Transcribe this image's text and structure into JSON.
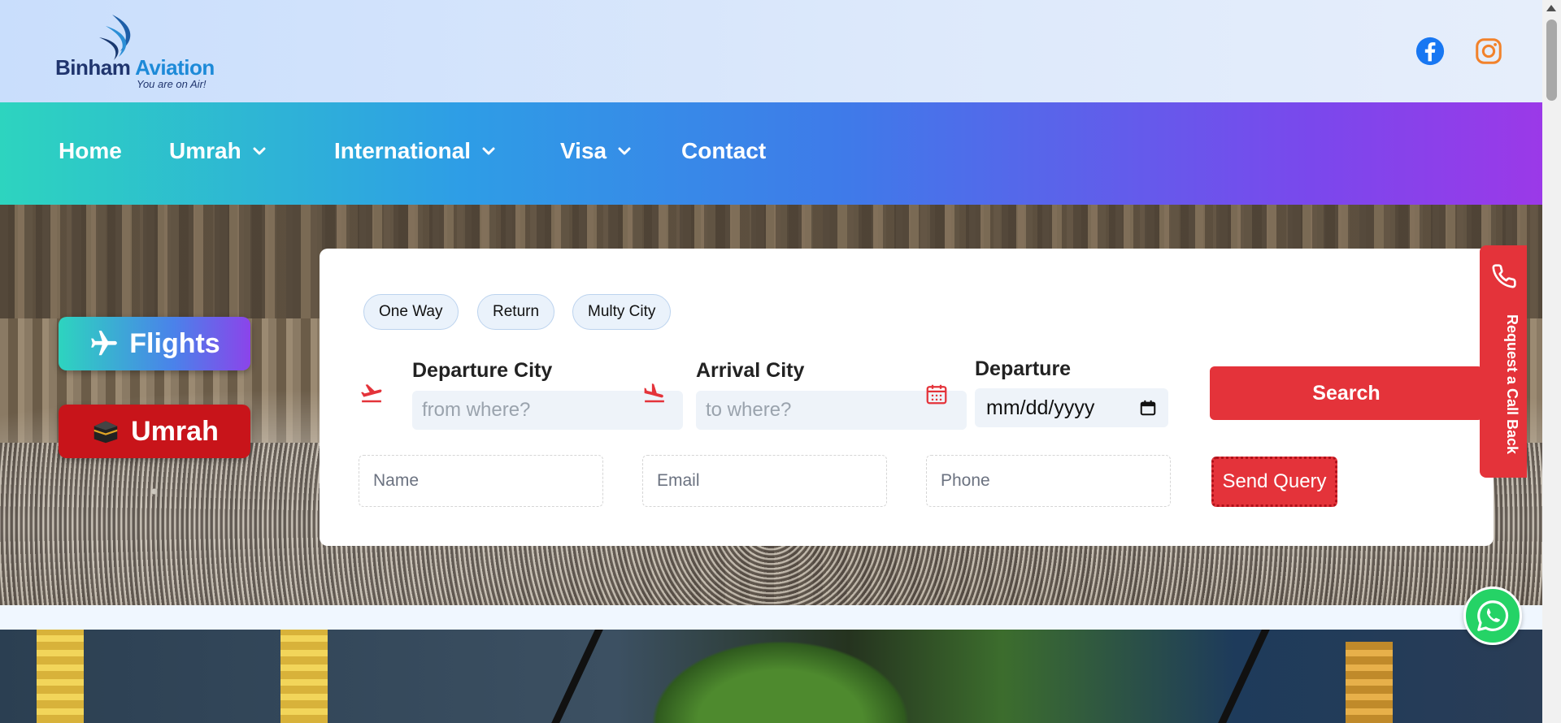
{
  "header": {
    "logo_brand_1": "Binham",
    "logo_brand_2": "Aviation",
    "logo_tagline": "You are on Air!",
    "social": [
      {
        "icon": "facebook-icon",
        "color": "#1877f2"
      },
      {
        "icon": "instagram-icon",
        "color": "#f2822b"
      }
    ]
  },
  "nav": {
    "items": [
      {
        "label": "Home",
        "has_dropdown": false
      },
      {
        "label": "Umrah",
        "has_dropdown": true
      },
      {
        "label": "International",
        "has_dropdown": true
      },
      {
        "label": "Visa",
        "has_dropdown": true
      },
      {
        "label": "Contact",
        "has_dropdown": false
      }
    ]
  },
  "side_tabs": {
    "flights": "Flights",
    "umrah": "Umrah"
  },
  "search": {
    "trip_types": [
      "One Way",
      "Return",
      "Multy City"
    ],
    "departure_label": "Departure City",
    "departure_placeholder": "from where?",
    "arrival_label": "Arrival City",
    "arrival_placeholder": "to where?",
    "date_label": "Departure",
    "date_placeholder": "mm/dd/yyyy",
    "search_button": "Search"
  },
  "query": {
    "name_placeholder": "Name",
    "email_placeholder": "Email",
    "phone_placeholder": "Phone",
    "send_button": "Send Query"
  },
  "callback": {
    "label": "Request a Call Back"
  },
  "colors": {
    "accent_red": "#e4333a",
    "nav_gradient_start": "#2dd4bf",
    "nav_gradient_end": "#9b39e8",
    "whatsapp": "#25d366"
  }
}
